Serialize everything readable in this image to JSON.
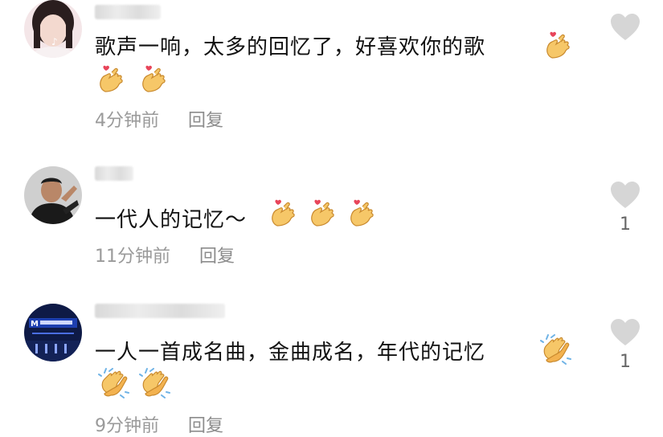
{
  "comments": [
    {
      "text": "歌声一响，太多的回忆了，好喜欢你的歌",
      "time": "4分钟前",
      "reply": "回复",
      "likes": ""
    },
    {
      "text": "一代人的记忆～",
      "time": "11分钟前",
      "reply": "回复",
      "likes": "1"
    },
    {
      "text": "一人一首成名曲，金曲成名，年代的记忆",
      "time": "9分钟前",
      "reply": "回复",
      "likes": "1"
    }
  ],
  "icons": {
    "like": "heart-icon",
    "finger_heart": "finger-heart-emoji",
    "clap": "clapping-hands-emoji"
  },
  "colors": {
    "text": "#111111",
    "meta": "#9a9a9a",
    "heart": "#d6d6d6"
  }
}
